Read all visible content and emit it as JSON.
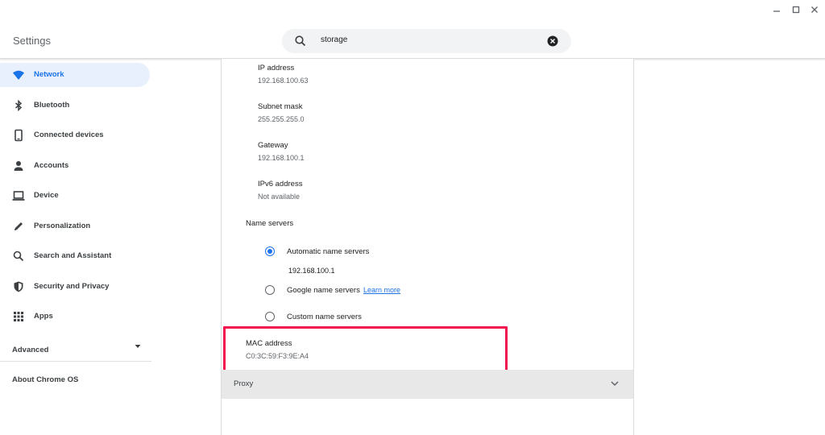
{
  "window": {
    "title": "Settings",
    "controls": [
      "minimize-icon",
      "maximize-icon",
      "close-icon"
    ]
  },
  "search": {
    "value": "storage",
    "icon": "search-icon",
    "clear_icon": "clear-icon"
  },
  "sidebar": {
    "items": [
      {
        "label": "Network",
        "icon": "wifi-icon",
        "selected": true
      },
      {
        "label": "Bluetooth",
        "icon": "bluetooth-icon"
      },
      {
        "label": "Connected devices",
        "icon": "phone-icon"
      },
      {
        "label": "Accounts",
        "icon": "person-icon"
      },
      {
        "label": "Device",
        "icon": "laptop-icon"
      },
      {
        "label": "Personalization",
        "icon": "pencil-icon"
      },
      {
        "label": "Search and Assistant",
        "icon": "search-icon"
      },
      {
        "label": "Security and Privacy",
        "icon": "shield-icon"
      },
      {
        "label": "Apps",
        "icon": "apps-grid-icon"
      }
    ],
    "advanced_label": "Advanced",
    "about_label": "About Chrome OS"
  },
  "network": {
    "properties": [
      {
        "label": "IP address",
        "value": "192.168.100.63"
      },
      {
        "label": "Subnet mask",
        "value": "255.255.255.0"
      },
      {
        "label": "Gateway",
        "value": "192.168.100.1"
      },
      {
        "label": "IPv6 address",
        "value": "Not available"
      }
    ],
    "name_servers": {
      "heading": "Name servers",
      "options": [
        {
          "label": "Automatic name servers",
          "selected": true,
          "detail": "192.168.100.1"
        },
        {
          "label": "Google name servers",
          "selected": false,
          "link": "Learn more"
        },
        {
          "label": "Custom name servers",
          "selected": false
        }
      ]
    },
    "mac": {
      "label": "MAC address",
      "value": "C0:3C:59:F3:9E:A4"
    },
    "proxy_label": "Proxy"
  },
  "colors": {
    "accent": "#1a73e8",
    "highlight": "#f0134d",
    "selected_bg": "#e8f0fe",
    "proxy_bg": "#e8e8e8"
  }
}
